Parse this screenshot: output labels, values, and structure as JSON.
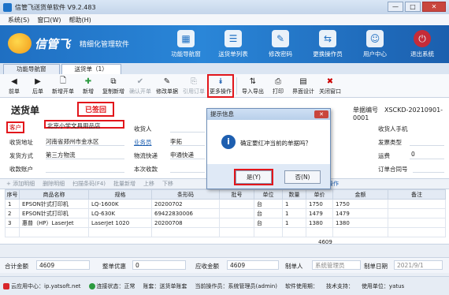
{
  "window": {
    "title": "信管飞送货单软件 V9.2.483",
    "minimize": "—",
    "maximize": "□",
    "close": "✕"
  },
  "menu": [
    "系统(S)",
    "窗口(W)",
    "帮助(H)"
  ],
  "banner": {
    "brand": "信管飞",
    "slogan": "精细化管理软件"
  },
  "topnav": [
    {
      "label": "功能导航窗",
      "icon": "▦"
    },
    {
      "label": "送货单列表",
      "icon": "☰"
    },
    {
      "label": "修改密码",
      "icon": "✎"
    },
    {
      "label": "更换操作员",
      "icon": "⇆"
    },
    {
      "label": "用户中心",
      "icon": "☺"
    },
    {
      "label": "退出系统",
      "icon": "⏻"
    }
  ],
  "tabs": [
    "功能导航窗",
    "送货单（1）"
  ],
  "toolbar": {
    "prev": "前单",
    "next": "后单",
    "new": "新增开单",
    "add": "新增",
    "copy_add": "复制新增",
    "confirm": "确认开单",
    "edit": "修改单据",
    "ref": "引用订单",
    "more": "更多操作",
    "import_export": "导入导出",
    "print": "打印",
    "ui": "界面设计",
    "close": "关闭窗口"
  },
  "doc": {
    "title": "送货单",
    "status": "已签回",
    "no_label": "单据编号",
    "no_value": "XSCKD-20210901-0001"
  },
  "form": {
    "customer_label": "客户",
    "customer_value": "北京小学文具用品店",
    "addr_label": "收货地址",
    "addr_value": "河南省郑州市金水区",
    "ship_label": "发货方式",
    "ship_value": "第三方物流",
    "acct_label": "收款账户",
    "receiver_label": "收货人",
    "sales_label": "业务员",
    "sales_value": "李拓",
    "logistics_label": "物流快递",
    "logistics_value": "申通快递",
    "collect_label": "本次收款",
    "phone_label": "收货人手机",
    "invoice_label": "发票类型",
    "freight_label": "运费",
    "freight_value": "0",
    "po_label": "订单合同号"
  },
  "subtoolbar": [
    "+ 添加明细",
    "删除明细",
    "扫描条码(F4)",
    "批量新增",
    "上移",
    "下移",
    "更多操作"
  ],
  "grid": {
    "headers": [
      "序号",
      "商品名称",
      "规格",
      "条形码",
      "批号",
      "单位",
      "数量",
      "单价",
      "金额",
      "备注"
    ],
    "rows": [
      [
        "1",
        "EPSON针式打印机",
        "LQ-1600K",
        "20200702",
        "",
        "台",
        "1",
        "1750",
        "1750",
        ""
      ],
      [
        "2",
        "EPSON针式打印机",
        "LQ-630K",
        "69422830006",
        "",
        "台",
        "1",
        "1479",
        "1479",
        ""
      ],
      [
        "3",
        "惠普（HP）LaserJet",
        "LaserJet 1020",
        "20200708",
        "",
        "台",
        "1",
        "1380",
        "1380",
        ""
      ]
    ],
    "total": "4609"
  },
  "footer": {
    "total_label": "合计金额",
    "total_value": "4609",
    "discount_label": "整单优惠",
    "discount_value": "0",
    "due_label": "应收金额",
    "due_value": "4609",
    "maker_label": "制单人",
    "maker_value": "系统管理员",
    "date_label": "制单日期",
    "date_value": "2021/9/1"
  },
  "statusbar": [
    "云应用中心：ip.yatsoft.net",
    "连接状态：正常",
    "账套：送货单账套",
    "当前操作员：系统管理员(admin)",
    "软件使用期：",
    "技术支持：",
    "使用单位：yatus"
  ],
  "dialog": {
    "title": "提示信息",
    "close": "✕",
    "message": "确定要红冲当前的单据吗？",
    "yes": "是(Y)",
    "no": "否(N)"
  }
}
